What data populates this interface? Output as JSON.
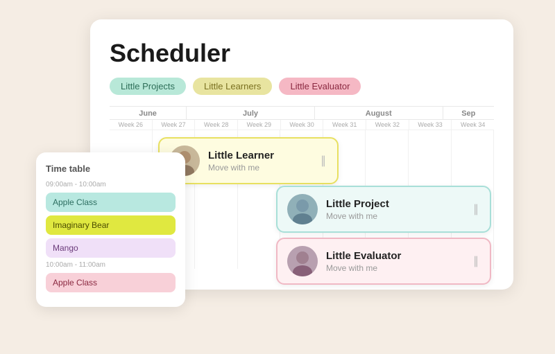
{
  "scheduler": {
    "title": "Scheduler",
    "tags": [
      {
        "label": "Little Projects",
        "style": "tag-green"
      },
      {
        "label": "Little Learners",
        "style": "tag-yellow"
      },
      {
        "label": "Little Evaluator",
        "style": "tag-pink"
      }
    ],
    "months": [
      {
        "label": "June",
        "weeks": [
          "Week 26",
          "Week 27"
        ]
      },
      {
        "label": "July",
        "weeks": [
          "Week 28",
          "Week 29",
          "Week 30"
        ]
      },
      {
        "label": "August",
        "weeks": [
          "Week 31",
          "Week 32",
          "Week 33"
        ]
      },
      {
        "label": "Sep",
        "weeks": [
          "Week 34"
        ]
      }
    ],
    "events": [
      {
        "name": "Little Learner",
        "sub": "Move with me",
        "style": "event-yellow",
        "avatar_style": "event-avatar-yellow",
        "avatar_emoji": "🧑"
      },
      {
        "name": "Little Project",
        "sub": "Move with me",
        "style": "event-teal",
        "avatar_style": "event-avatar-teal",
        "avatar_emoji": "👩"
      },
      {
        "name": "Little Evaluator",
        "sub": "Move with me",
        "style": "event-pink",
        "avatar_style": "event-avatar-pink",
        "avatar_emoji": "👦"
      }
    ]
  },
  "timetable": {
    "title": "Time table",
    "sections": [
      {
        "time": "09:00am - 10:00am",
        "classes": [
          {
            "label": "Apple Class",
            "style": "class-teal"
          },
          {
            "label": "Imaginary Bear",
            "style": "class-yellow"
          },
          {
            "label": "Mango",
            "style": "class-pink-light"
          }
        ]
      },
      {
        "time": "10:00am - 11:00am",
        "classes": [
          {
            "label": "Apple Class",
            "style": "class-pink2"
          }
        ]
      }
    ]
  }
}
